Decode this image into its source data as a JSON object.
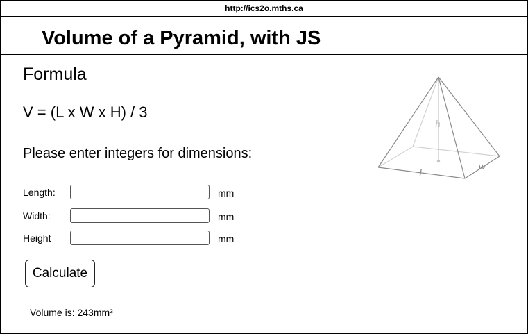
{
  "browser": {
    "url": "http://ics2o.mths.ca"
  },
  "header": {
    "title": "Volume of a Pyramid, with JS"
  },
  "main": {
    "formula_heading": "Formula",
    "formula": "V = (L x W x H) / 3",
    "instructions": "Please enter integers for dimensions:",
    "fields": [
      {
        "label": "Length:",
        "value": "",
        "unit": "mm"
      },
      {
        "label": "Width:",
        "value": "",
        "unit": "mm"
      },
      {
        "label": "Height",
        "value": "",
        "unit": "mm"
      }
    ],
    "calculate_label": "Calculate",
    "result": "Volume is: 243mm³"
  },
  "illustration": {
    "icon": "pyramid-diagram",
    "labels": {
      "height": "h",
      "length": "l",
      "width": "w"
    }
  }
}
